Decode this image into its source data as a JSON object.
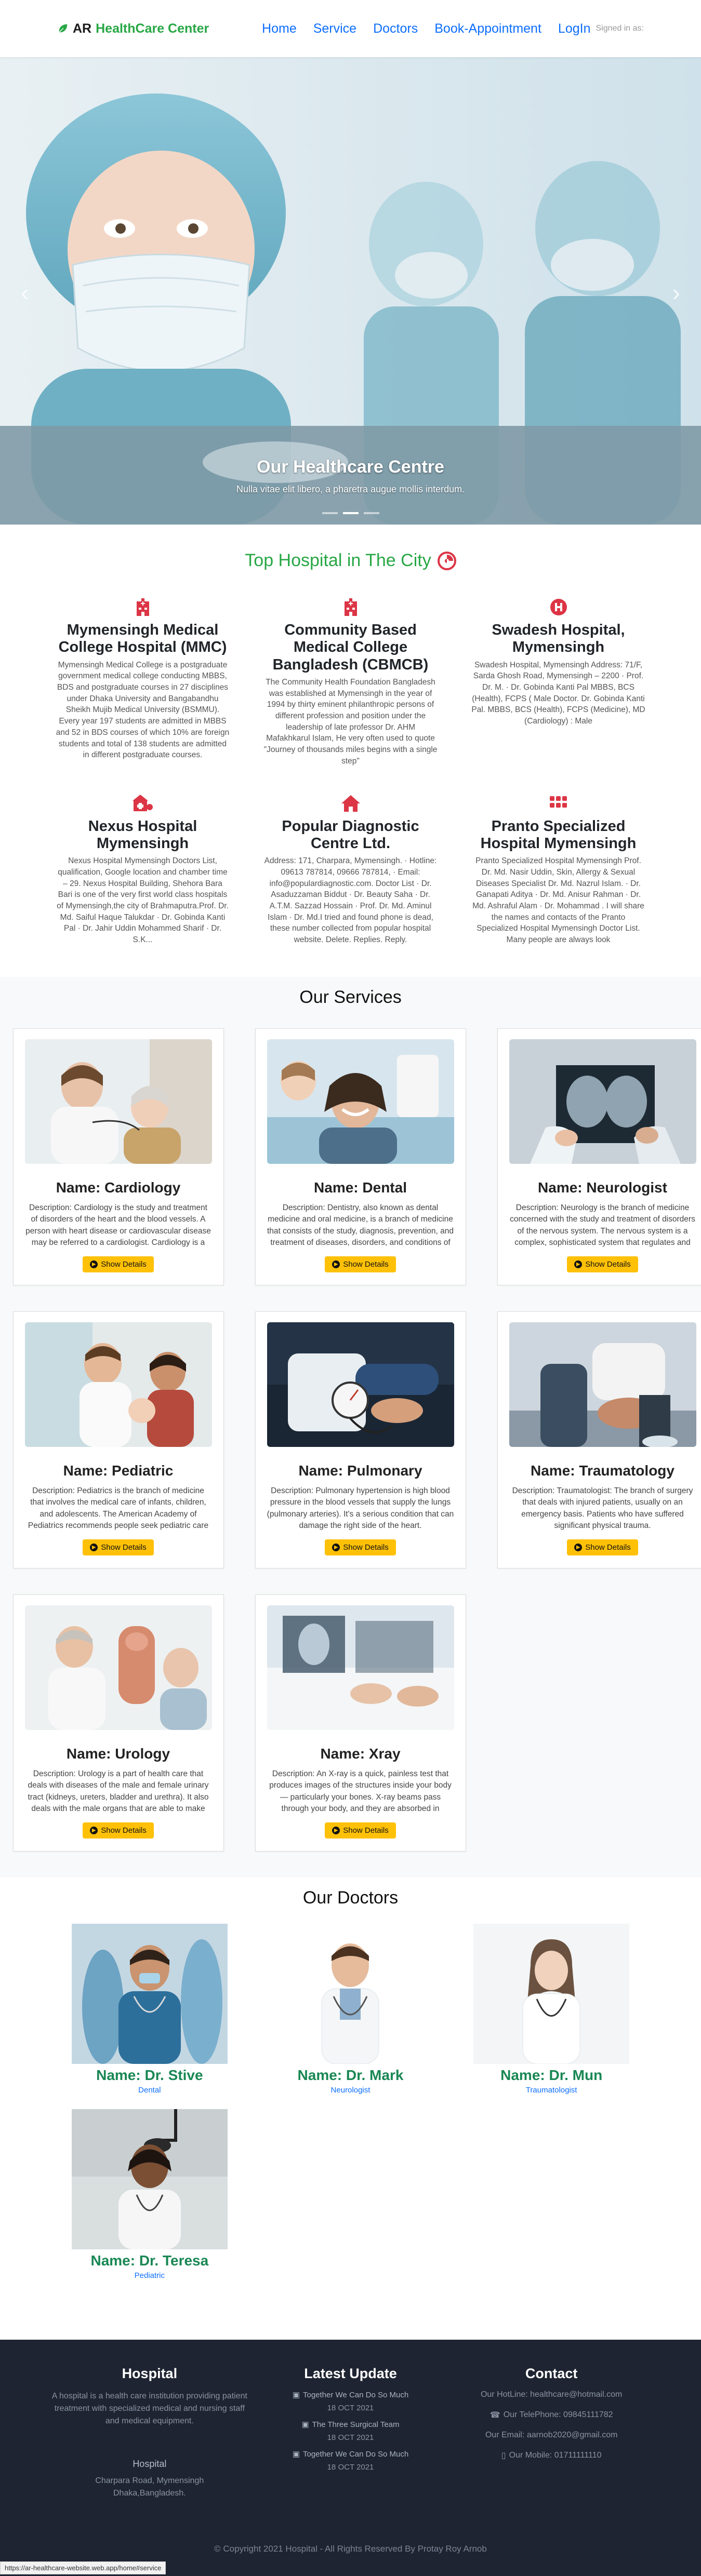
{
  "navbar": {
    "brand_prefix": "AR ",
    "brand_name": "HealthCare Center",
    "links": [
      "Home",
      "Service",
      "Doctors",
      "Book-Appointment",
      "LogIn"
    ],
    "signed_status": "Signed in as:"
  },
  "hero": {
    "caption_title": "Our Healthcare Centre",
    "caption_subtitle": "Nulla vitae elit libero, a pharetra augue mollis interdum.",
    "slides": 3,
    "active_slide": 2
  },
  "top_hospitals": {
    "title": "Top Hospital in The City",
    "items": [
      {
        "icon": "hospital-building-icon",
        "name": "Mymensingh Medical College Hospital (MMC)",
        "description": "Mymensingh Medical College is a postgraduate government medical college conducting MBBS, BDS and postgraduate courses in 27 disciplines under Dhaka University and Bangabandhu Sheikh Mujib Medical University (BSMMU). Every year 197 students are admitted in MBBS and 52 in BDS courses of which 10% are foreign students and total of 138 students are admitted in different postgraduate courses."
      },
      {
        "icon": "hospital-building-icon",
        "name": "Community Based Medical College Bangladesh (CBMCB)",
        "description": "The Community Health Foundation Bangladesh was established at Mymensingh in the year of 1994 by thirty eminent philanthropic persons of different profession and position under the leadership of late professor Dr. AHM Mafakhkarul Islam, He very often used to quote \"Journey of thousands miles begins with a single step\""
      },
      {
        "icon": "hospital-h-icon",
        "name": "Swadesh Hospital, Mymensingh",
        "description": "Swadesh Hospital, Mymensingh Address: 71/F, Sarda Ghosh Road, Mymensingh – 2200 · Prof. Dr. M. · Dr. Gobinda Kanti Pal MBBS, BCS (Health), FCPS ( Male Doctor. Dr. Gobinda Kanti Pal. MBBS, BCS (Health), FCPS (Medicine), MD (Cardiology) : Male"
      },
      {
        "icon": "clinic-medical-icon",
        "name": "Nexus Hospital Mymensingh",
        "description": "Nexus Hospital Mymensingh Doctors List, qualification, Google location and chamber time – 29. Nexus Hospital Building, Shehora Bara Bari is one of the very first world class hospitals of Mymensingh,the city of Brahmaputra.Prof. Dr. Md. Saiful Haque Talukdar · Dr. Gobinda Kanti Pal · Dr. Jahir Uddin Mohammed Sharif · Dr. S.K..."
      },
      {
        "icon": "home-icon",
        "name": "Popular Diagnostic Centre Ltd.",
        "description": "Address: 171, Charpara, Mymensingh. · Hotline: 09613 787814, 09666 787814, · Email: info@populardiagnostic.com. Doctor List · Dr. Asaduzzaman Biddut · Dr. Beauty Saha · Dr. A.T.M. Sazzad Hossain · Prof. Dr. Md. Aminul Islam · Dr. Md.I tried and found phone is dead, these number collected from popular hospital website. Delete. Replies. Reply."
      },
      {
        "icon": "grid-icon",
        "name": "Pranto Specialized Hospital Mymensingh",
        "description": "Pranto Specialized Hospital Mymensingh Prof. Dr. Md. Nasir Uddin, Skin, Allergy & Sexual Diseases Specialist Dr. Md. Nazrul Islam. · Dr. Ganapati Aditya · Dr. Md. Anisur Rahman · Dr. Md. Ashraful Alam · Dr. Mohammad . I will share the names and contacts of the Pranto Specialized Hospital Mymensingh Doctor List. Many people are always look"
      }
    ]
  },
  "services": {
    "title": "Our Services",
    "button_label": "Show Details",
    "items": [
      {
        "name": "Name: Cardiology",
        "description": "Description: Cardiology is the study and treatment of disorders of the heart and the blood vessels. A person with heart disease or cardiovascular disease may be referred to a cardiologist. Cardiology is a branch of internal medicine. ..."
      },
      {
        "name": "Name: Dental",
        "description": "Description: Dentistry, also known as dental medicine and oral medicine, is a branch of medicine that consists of the study, diagnosis, prevention, and treatment of diseases, disorders, and conditions of the oral ..."
      },
      {
        "name": "Name: Neurologist",
        "description": "Description: Neurology is the branch of medicine concerned with the study and treatment of disorders of the nervous system. The nervous system is a complex, sophisticated system that regulates and coordinates body activities. It has two major divisions"
      },
      {
        "name": "Name: Pediatric",
        "description": "Description: Pediatrics is the branch of medicine that involves the medical care of infants, children, and adolescents. The American Academy of Pediatrics recommends people seek pediatric care through the."
      },
      {
        "name": "Name: Pulmonary",
        "description": "Description: Pulmonary hypertension is high blood pressure in the blood vessels that supply the lungs (pulmonary arteries). It's a serious condition that can damage the right side of the heart."
      },
      {
        "name": "Name: Traumatology",
        "description": "Description: Traumatologist: The branch of surgery that deals with injured patients, usually on an emergency basis. Patients who have suffered significant physical trauma."
      },
      {
        "name": "Name: Urology",
        "description": "Description: Urology is a part of health care that deals with diseases of the male and female urinary tract (kidneys, ureters, bladder and urethra). It also deals with the male organs that are able to make babies (penis, testes, scrotum, prostate, etc.)."
      },
      {
        "name": "Name: Xray",
        "description": "Description: An X-ray is a quick, painless test that produces images of the structures inside your body — particularly your bones. X-ray beams pass through your body, and they are absorbed in different amounts depending on the density of the material ."
      }
    ]
  },
  "doctors": {
    "title": "Our Doctors",
    "items": [
      {
        "name": "Name: Dr. Stive",
        "specialty": "Dental"
      },
      {
        "name": "Name: Dr. Mark",
        "specialty": "Neurologist"
      },
      {
        "name": "Name: Dr. Mun",
        "specialty": "Traumatologist"
      },
      {
        "name": "Name: Dr. Teresa",
        "specialty": "Pediatric"
      }
    ]
  },
  "footer": {
    "hospital_title": "Hospital",
    "hospital_text": "A hospital is a health care institution providing patient treatment with specialized medical and nursing staff and medical equipment.",
    "address_title": "Hospital",
    "address_line1": "Charpara Road, Mymensingh",
    "address_line2": "Dhaka,Bangladesh.",
    "updates_title": "Latest Update",
    "updates": [
      {
        "title": "Together We Can Do So Much",
        "date": "18 OCT 2021"
      },
      {
        "title": "The Three Surgical Team",
        "date": "18 OCT 2021"
      },
      {
        "title": "Together We Can Do So Much",
        "date": "18 OCT 2021"
      }
    ],
    "contact_title": "Contact",
    "hotline": "Our HotLine: healthcare@hotmail.com",
    "telephone": "Our TelePhone: 09845111782",
    "email": "Our Email: aarnob2020@gmail.com",
    "mobile": "Our Mobile: 01711111110",
    "copyright": "© Copyright 2021 Hospital - All Rights Reserved By Protay Roy Arnob"
  },
  "status_bar_url": "https://ar-healthcare-website.web.app/home#service"
}
